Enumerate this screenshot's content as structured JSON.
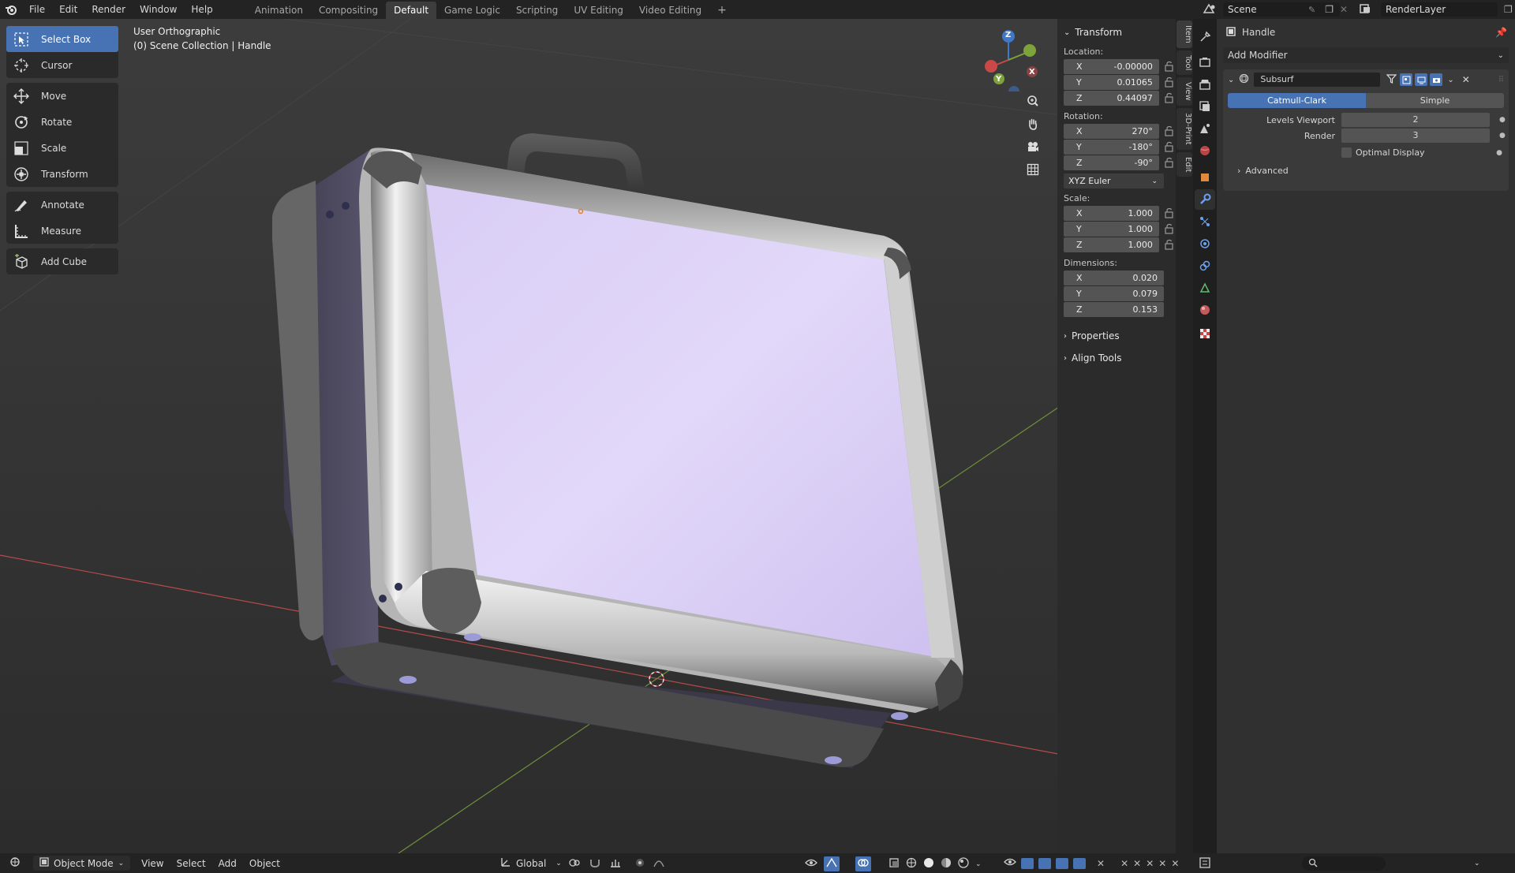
{
  "topbar": {
    "menus": [
      "File",
      "Edit",
      "Render",
      "Window",
      "Help"
    ],
    "workspaces": [
      "Animation",
      "Compositing",
      "Default",
      "Game Logic",
      "Scripting",
      "UV Editing",
      "Video Editing"
    ],
    "active_workspace": "Default",
    "add_workspace": "+",
    "scene": "Scene",
    "render_layer": "RenderLayer"
  },
  "viewport": {
    "view_name": "User Orthographic",
    "collection_line": "(0) Scene Collection | Handle",
    "gizmo": {
      "x": "X",
      "y": "Y",
      "z": "Z"
    }
  },
  "toolbar": {
    "tools": [
      {
        "label": "Select Box",
        "icon": "select-box-icon",
        "active": true
      },
      {
        "label": "Cursor",
        "icon": "cursor-icon"
      },
      {
        "label": "Move",
        "icon": "move-icon"
      },
      {
        "label": "Rotate",
        "icon": "rotate-icon"
      },
      {
        "label": "Scale",
        "icon": "scale-icon"
      },
      {
        "label": "Transform",
        "icon": "transform-icon"
      },
      {
        "label": "Annotate",
        "icon": "annotate-icon"
      },
      {
        "label": "Measure",
        "icon": "measure-icon"
      },
      {
        "label": "Add Cube",
        "icon": "add-cube-icon"
      }
    ]
  },
  "npanel": {
    "title": "Transform",
    "location_label": "Location:",
    "location": [
      {
        "axis": "X",
        "value": "-0.00000"
      },
      {
        "axis": "Y",
        "value": "0.01065"
      },
      {
        "axis": "Z",
        "value": "0.44097"
      }
    ],
    "rotation_label": "Rotation:",
    "rotation": [
      {
        "axis": "X",
        "value": "270°"
      },
      {
        "axis": "Y",
        "value": "-180°"
      },
      {
        "axis": "Z",
        "value": "-90°"
      }
    ],
    "rotation_mode": "XYZ Euler",
    "scale_label": "Scale:",
    "scale": [
      {
        "axis": "X",
        "value": "1.000"
      },
      {
        "axis": "Y",
        "value": "1.000"
      },
      {
        "axis": "Z",
        "value": "1.000"
      }
    ],
    "dimensions_label": "Dimensions:",
    "dimensions": [
      {
        "axis": "X",
        "value": "0.020"
      },
      {
        "axis": "Y",
        "value": "0.079"
      },
      {
        "axis": "Z",
        "value": "0.153"
      }
    ],
    "properties": "Properties",
    "align_tools": "Align Tools"
  },
  "sidebar_tabs": [
    "Item",
    "Tool",
    "View",
    "3D-Print",
    "Edit"
  ],
  "properties": {
    "object_name": "Handle",
    "add_modifier": "Add Modifier",
    "modifier_name": "Subsurf",
    "catmull_clark": "Catmull-Clark",
    "simple": "Simple",
    "levels_viewport_label": "Levels Viewport",
    "levels_viewport_value": "2",
    "render_label": "Render",
    "render_value": "3",
    "optimal_display": "Optimal Display",
    "advanced": "Advanced"
  },
  "bottombar": {
    "mode": "Object Mode",
    "menus": [
      "View",
      "Select",
      "Add",
      "Object"
    ],
    "orientation": "Global"
  },
  "colors": {
    "accent": "#4772b3",
    "x_axis": "#c94848",
    "y_axis": "#7ea33b",
    "z_axis": "#3d78c9"
  }
}
